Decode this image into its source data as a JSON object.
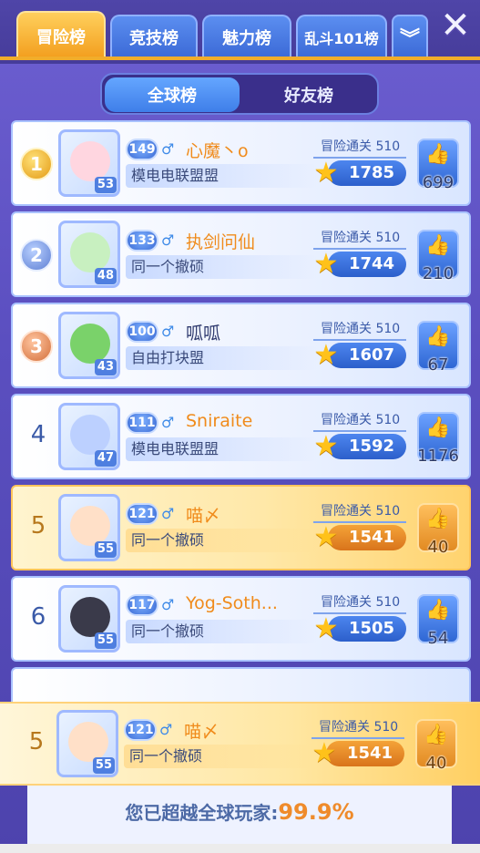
{
  "tabs": [
    {
      "label": "冒险榜",
      "active": true
    },
    {
      "label": "竞技榜",
      "active": false
    },
    {
      "label": "魅力榜",
      "active": false
    },
    {
      "label": "乱斗101榜",
      "active": false
    }
  ],
  "more_tabs_icon": "chevron-double-down-icon",
  "close_icon": "close-icon",
  "segmented": {
    "global": "全球榜",
    "friends": "好友榜",
    "selected": "全球榜"
  },
  "rows": [
    {
      "rank": "1",
      "medal": "gold",
      "avatar_level": "53",
      "level": "149",
      "gender": "♂",
      "name": "心魔丶o",
      "name_color": "orange",
      "guild": "模电电联盟盟",
      "stage_label": "冒险通关",
      "stage": "510",
      "score": "1785",
      "likes": "699",
      "highlight": false
    },
    {
      "rank": "2",
      "medal": "silver",
      "avatar_level": "48",
      "level": "133",
      "gender": "♂",
      "name": "执剑问仙",
      "name_color": "orange",
      "guild": "同一个撤硕",
      "stage_label": "冒险通关",
      "stage": "510",
      "score": "1744",
      "likes": "210",
      "highlight": false
    },
    {
      "rank": "3",
      "medal": "bronze",
      "avatar_level": "43",
      "level": "100",
      "gender": "♂",
      "name": "呱呱",
      "name_color": "dark",
      "guild": "自由打块盟",
      "stage_label": "冒险通关",
      "stage": "510",
      "score": "1607",
      "likes": "67",
      "highlight": false
    },
    {
      "rank": "4",
      "medal": "",
      "avatar_level": "47",
      "level": "111",
      "gender": "♂",
      "name": "Sniraite",
      "name_color": "orange",
      "guild": "模电电联盟盟",
      "stage_label": "冒险通关",
      "stage": "510",
      "score": "1592",
      "likes": "1176",
      "highlight": false
    },
    {
      "rank": "5",
      "medal": "",
      "avatar_level": "55",
      "level": "121",
      "gender": "♂",
      "name": "喵〆",
      "name_color": "orange",
      "guild": "同一个撤硕",
      "stage_label": "冒险通关",
      "stage": "510",
      "score": "1541",
      "likes": "40",
      "highlight": true
    },
    {
      "rank": "6",
      "medal": "",
      "avatar_level": "55",
      "level": "117",
      "gender": "♂",
      "name": "Yog-Soth...",
      "name_color": "orange",
      "guild": "同一个撤硕",
      "stage_label": "冒险通关",
      "stage": "510",
      "score": "1505",
      "likes": "54",
      "highlight": false
    }
  ],
  "mine": {
    "rank": "5",
    "avatar_level": "55",
    "level": "121",
    "gender": "♂",
    "name": "喵〆",
    "guild": "同一个撤硕",
    "stage_label": "冒险通关",
    "stage": "510",
    "score": "1541",
    "likes": "40"
  },
  "footer": {
    "text": "您已超越全球玩家:",
    "percent": "99.9%"
  }
}
